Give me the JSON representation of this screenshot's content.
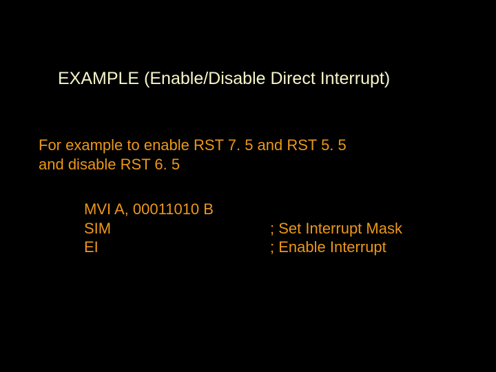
{
  "title": "EXAMPLE (Enable/Disable Direct Interrupt)",
  "intro_line1": "For example to enable RST 7. 5 and RST 5. 5",
  "intro_line2": "and disable RST 6. 5",
  "code": {
    "line1_instr": "MVI A, 00011010 B",
    "line2_instr": "SIM",
    "line2_comment": "; Set Interrupt Mask",
    "line3_instr": "EI",
    "line3_comment": "; Enable Interrupt"
  }
}
